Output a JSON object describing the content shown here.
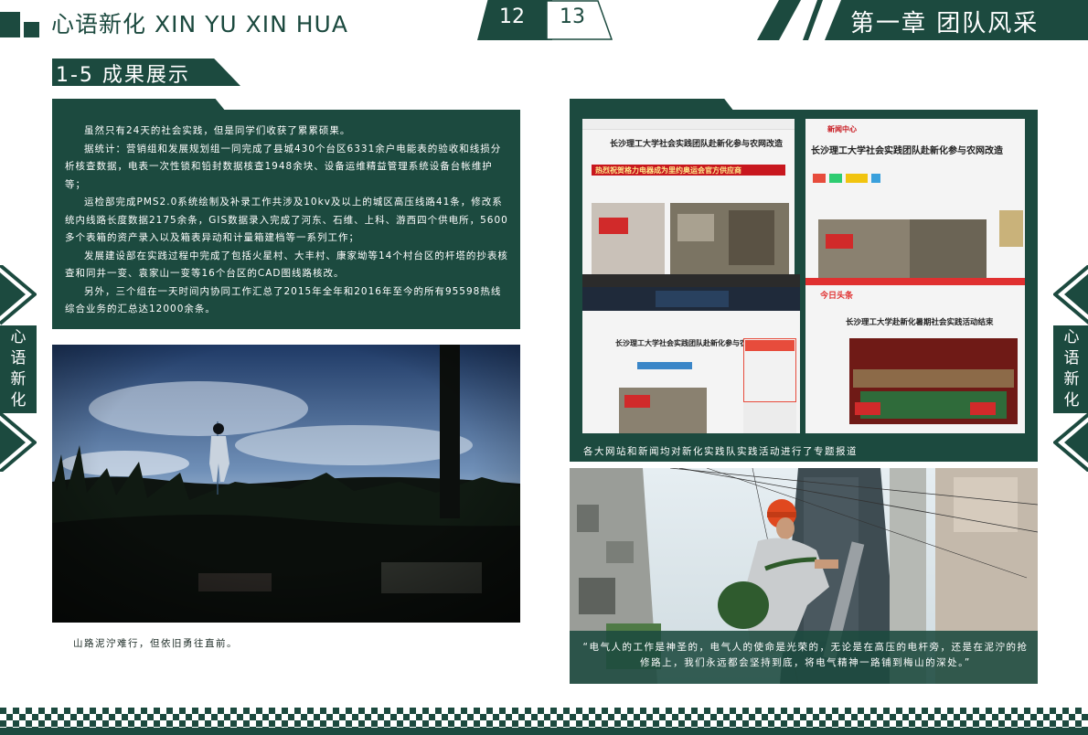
{
  "header": {
    "title": "心语新化 XIN YU XIN HUA",
    "page_left": "12",
    "page_right": "13",
    "chapter": "第一章  团队风采"
  },
  "section": {
    "label": "1-5 成果展示"
  },
  "text_panel": {
    "paragraphs": [
      "虽然只有24天的社会实践，但是同学们收获了累累硕果。",
      "据统计：营销组和发展规划组一同完成了县城430个台区6331余户电能表的验收和线损分析核查数据，电表一次性锁和铅封数据核查1948余块、设备运维精益管理系统设备台帐维护等；",
      "运检部完成PMS2.0系统绘制及补录工作共涉及10kv及以上的城区高压线路41条，修改系统内线路长度数据2175余条，GIS数据录入完成了河东、石维、上科、游西四个供电所，5600多个表箱的资产录入以及箱表异动和计量箱建档等一系列工作；",
      "发展建设部在实践过程中完成了包括火星村、大丰村、康家坳等14个村台区的杆塔的抄表核查和同井一变、袁家山一变等16个台区的CAD图线路核改。",
      "另外，三个组在一天时间内协同工作汇总了2015年全年和2016年至今的所有95598热线综合业务的汇总达12000余条。"
    ]
  },
  "left_photo": {
    "caption": "山路泥泞难行，但依旧勇往直前。"
  },
  "news_panel": {
    "caption": "各大网站和新闻均对新化实践队实践活动进行了专题报道",
    "shots": [
      {
        "headline": "长沙理工大学社会实践团队赴新化参与农网改造",
        "banner": "热烈祝贺格力电器成为里约奥运会官方供应商"
      },
      {
        "site": "新闻中心",
        "headline": "长沙理工大学社会实践团队赴新化参与农网改造"
      },
      {
        "headline": "长沙理工大学社会实践团队赴新化参与农网改造"
      },
      {
        "site": "今日头条",
        "headline": "长沙理工大学赴新化暑期社会实践活动结束"
      }
    ]
  },
  "right_photo": {
    "quote": "“电气人的工作是神圣的，电气人的使命是光荣的，无论是在高压的电杆旁，还是在泥泞的抢修路上，我们永远都会坚持到底，将电气精神一路铺到梅山的深处。”"
  },
  "side_tabs": {
    "left": [
      "心",
      "语",
      "新",
      "化"
    ],
    "right": [
      "心",
      "语",
      "新",
      "化"
    ]
  },
  "colors": {
    "accent": "#1c4a3f",
    "banner_red": "#c8171e"
  }
}
